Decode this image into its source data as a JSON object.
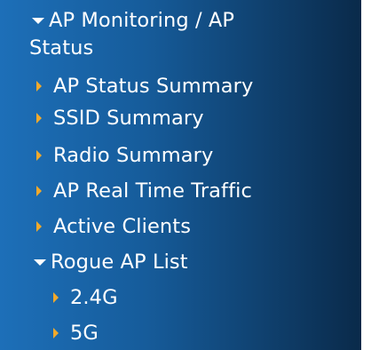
{
  "nav": {
    "section_title_line1": "AP Monitoring / AP",
    "section_title_line2": "Status",
    "items": [
      {
        "label": "AP Status Summary",
        "icon": "caret-right-icon"
      },
      {
        "label": "SSID Summary",
        "icon": "caret-right-icon"
      },
      {
        "label": "Radio Summary",
        "icon": "caret-right-icon"
      },
      {
        "label": "AP Real Time Traffic",
        "icon": "caret-right-icon"
      },
      {
        "label": "Active Clients",
        "icon": "caret-right-icon"
      }
    ],
    "rogue": {
      "label": "Rogue AP List",
      "icon": "caret-down-icon",
      "children": [
        {
          "label": "2.4G",
          "icon": "caret-right-icon"
        },
        {
          "label": "5G",
          "icon": "caret-right-icon"
        }
      ]
    }
  },
  "colors": {
    "panel_left": "#1d6fb8",
    "panel_right": "#0a2a4a",
    "caret_orange": "#f2a92b",
    "text": "#ffffff"
  }
}
